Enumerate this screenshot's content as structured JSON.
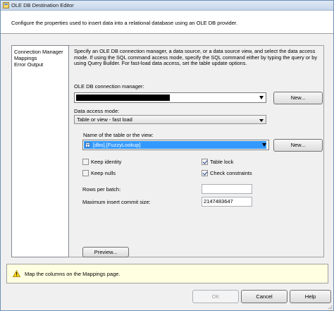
{
  "window": {
    "title": "OLE DB Destination Editor"
  },
  "header": {
    "description": "Configure the properties used to insert data into a relational database using an OLE DB provider."
  },
  "nav": {
    "items": [
      {
        "label": "Connection Manager"
      },
      {
        "label": "Mappings"
      },
      {
        "label": "Error Output"
      }
    ]
  },
  "content": {
    "description": "Specify an OLE DB connection manager, a data source, or a data source view, and select the data access mode. If using the SQL command access mode, specify the SQL command either by typing the query or by using Query Builder. For fast-load data access, set the table update options.",
    "connection_manager": {
      "label": "OLE DB connection manager:",
      "new_label": "New..."
    },
    "access_mode": {
      "label": "Data access mode:",
      "value": "Table or view - fast load"
    },
    "table": {
      "label": "Name of the table or the view:",
      "value": "[dbo].[FuzzyLookup]",
      "new_label": "New..."
    },
    "options": {
      "keep_identity": {
        "label": "Keep identity",
        "checked": false
      },
      "keep_nulls": {
        "label": "Keep nulls",
        "checked": false
      },
      "table_lock": {
        "label": "Table lock",
        "checked": true
      },
      "check_constraints": {
        "label": "Check constraints",
        "checked": true
      }
    },
    "rows_per_batch": {
      "label": "Rows per batch:",
      "value": ""
    },
    "max_commit": {
      "label": "Maximum insert commit size:",
      "value": "2147483647"
    },
    "preview_label": "Preview..."
  },
  "message": {
    "text": "Map the columns on the Mappings page.",
    "icon": "warning-icon"
  },
  "footer": {
    "ok_label": "OK",
    "cancel_label": "Cancel",
    "help_label": "Help"
  },
  "colors": {
    "selection": "#3399ff",
    "message_background": "#ffffe1",
    "check_color": "#1b3a8c"
  }
}
